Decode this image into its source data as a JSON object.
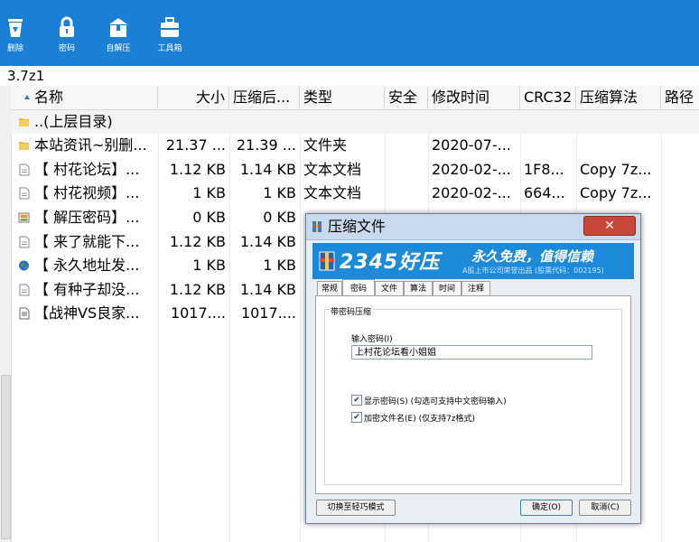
{
  "toolbar": {
    "buttons": [
      {
        "label": "删除",
        "icon": "recycle-bin-icon"
      },
      {
        "label": "密码",
        "icon": "lock-icon"
      },
      {
        "label": "自解压",
        "icon": "package-icon"
      },
      {
        "label": "工具箱",
        "icon": "toolbox-icon"
      }
    ]
  },
  "path": "3.7z1",
  "columns": [
    "名称",
    "大小",
    "压缩后...",
    "类型",
    "安全",
    "修改时间",
    "CRC32",
    "压缩算法",
    "路径"
  ],
  "rows": [
    {
      "name": "..(上层目录)",
      "size": "",
      "packed": "",
      "type": "",
      "modified": "",
      "crc": "",
      "method": "",
      "icon": "folder-icon"
    },
    {
      "name": "本站资讯~别删...",
      "size": "21.37 ...",
      "packed": "21.39 ...",
      "type": "文件夹",
      "modified": "2020-07-...",
      "crc": "",
      "method": "",
      "icon": "folder-icon"
    },
    {
      "name": "【 村花论坛】...",
      "size": "1.12 KB",
      "packed": "1.14 KB",
      "type": "文本文档",
      "modified": "2020-02-...",
      "crc": "1F8...",
      "method": "Copy 7z...",
      "icon": "text-file-icon"
    },
    {
      "name": "【 村花视频】...",
      "size": "1 KB",
      "packed": "1 KB",
      "type": "文本文档",
      "modified": "2020-02-...",
      "crc": "664...",
      "method": "Copy 7z...",
      "icon": "text-file-icon"
    },
    {
      "name": "【 解压密码】...",
      "size": "0 KB",
      "packed": "0 KB",
      "type": "",
      "modified": "",
      "crc": "",
      "method": "",
      "icon": "image-file-icon"
    },
    {
      "name": "【 来了就能下...",
      "size": "1.12 KB",
      "packed": "1.14 KB",
      "type": "",
      "modified": "",
      "crc": "",
      "method": "",
      "icon": "text-file-icon"
    },
    {
      "name": "【 永久地址发...",
      "size": "1 KB",
      "packed": "1 KB",
      "type": "",
      "modified": "",
      "crc": "",
      "method": "",
      "icon": "globe-icon"
    },
    {
      "name": "【 有种子却没...",
      "size": "1.12 KB",
      "packed": "1.14 KB",
      "type": "",
      "modified": "",
      "crc": "",
      "method": "",
      "icon": "text-file-icon"
    },
    {
      "name": "【战神VS良家...",
      "size": "1017....",
      "packed": "1017....",
      "type": "",
      "modified": "",
      "crc": "",
      "method": "",
      "icon": "document-icon"
    }
  ],
  "dialog": {
    "title": "压缩文件",
    "close_label": "✕",
    "banner": {
      "brand": "2345好压",
      "slogan": "永久免费，值得信赖",
      "subline": "A股上市公司荣誉出品 (股票代码：002195)"
    },
    "tabs": [
      "常规",
      "密码",
      "文件",
      "算法",
      "时间",
      "注释"
    ],
    "active_tab": "密码",
    "group_label": "带密码压缩",
    "password_label": "输入密码(I)",
    "password_value": "上村花论坛看小姐姐",
    "show_password": {
      "label": "显示密码(S)   (勾选可支持中文密码输入)",
      "checked": true
    },
    "encrypt_names": {
      "label": "加密文件名(E)   (仅支持7z格式)",
      "checked": true
    },
    "mode_button": "切换至轻巧模式",
    "ok_button": "确定(O)",
    "cancel_button": "取消(C)"
  },
  "colors": {
    "toolbar": "#1b7fd6",
    "banner": "#1c8ad8",
    "close": "#c9473a"
  }
}
